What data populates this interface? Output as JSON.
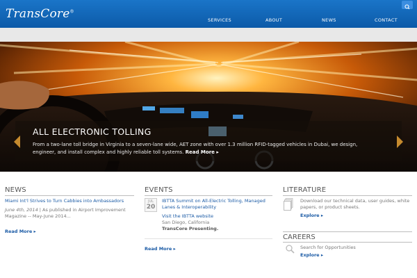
{
  "header": {
    "logo": "TransCore",
    "logo_mark": "®",
    "nav": [
      "SERVICES",
      "ABOUT",
      "NEWS",
      "CONTACT"
    ]
  },
  "hero": {
    "title": "ALL ELECTRONIC TOLLING",
    "text": "From a two-lane toll bridge in Virginia to a seven-lane wide, AET zone with over 1.3 million RFID-tagged vehicles in Dubai, we design, engineer, and install complex and highly reliable toll systems.",
    "more": "Read More ▸"
  },
  "news": {
    "title": "NEWS",
    "headline": "Miami Int'l Strives to Turn Cabbies into Ambassadors",
    "date": "June 4th, 2014",
    "meta": " | As published in Airport Improvement Magazine -- May-June 2014...",
    "more": "Read More"
  },
  "events": {
    "title": "EVENTS",
    "month": "JUL",
    "day": "20",
    "headline": "IBTTA Summit on All-Electric Tolling, Managed Lanes & Interoperability",
    "website": "Visit the IBTTA website",
    "place": "San Diego, California",
    "presenting": "TransCore Presenting.",
    "more": "Read More"
  },
  "literature": {
    "title": "LITERATURE",
    "text": "Download our technical data, user guides, white papers, or product sheets.",
    "explore": "Explore"
  },
  "careers": {
    "title": "CAREERS",
    "text": "Search for Opportunities",
    "explore": "Explore"
  },
  "colors": {
    "header_blue": "#0c5aa8",
    "link_blue": "#1a5aa5",
    "accent_orange": "#c58a2e"
  },
  "icons": [
    "search-icon",
    "arrow-left-icon",
    "arrow-right-icon",
    "document-icon",
    "calendar-icon",
    "search-icon-large"
  ]
}
